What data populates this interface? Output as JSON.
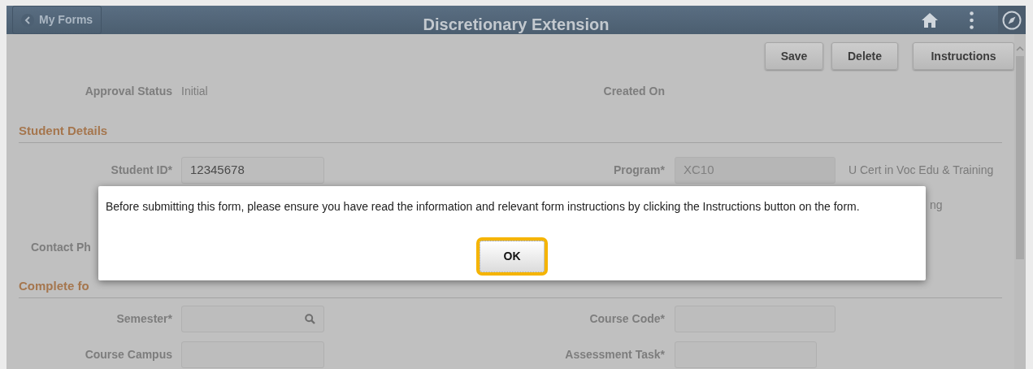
{
  "header": {
    "back_button": "My Forms",
    "title": "Discretionary Extension"
  },
  "toolbar": [
    "Save",
    "Delete",
    "Instructions"
  ],
  "summary": {
    "approval_label": "Approval Status",
    "approval_value": "Initial",
    "created_label": "Created On"
  },
  "student_section": {
    "heading": "Student Details",
    "rows": [
      {
        "left_label": "Student ID*",
        "left_value": "12345678",
        "right_label": "Program*",
        "right_value": "XC10",
        "right_note": "U Cert in Voc Edu & Training"
      },
      {
        "right_note": "ng"
      },
      {
        "left_label": "Contact Ph"
      }
    ]
  },
  "course_section": {
    "heading": "Complete fo",
    "rows": [
      {
        "left_label": "Semester*",
        "left_lookup": true,
        "right_label": "Course Code*"
      },
      {
        "left_label": "Course Campus",
        "right_label": "Assessment Task*",
        "right_short": true
      }
    ]
  },
  "dialog": {
    "message": "Before submitting this form, please ensure you have read the information and relevant form instructions by clicking the Instructions button on the form.",
    "button": {
      "label": "OK",
      "focused": true
    }
  }
}
